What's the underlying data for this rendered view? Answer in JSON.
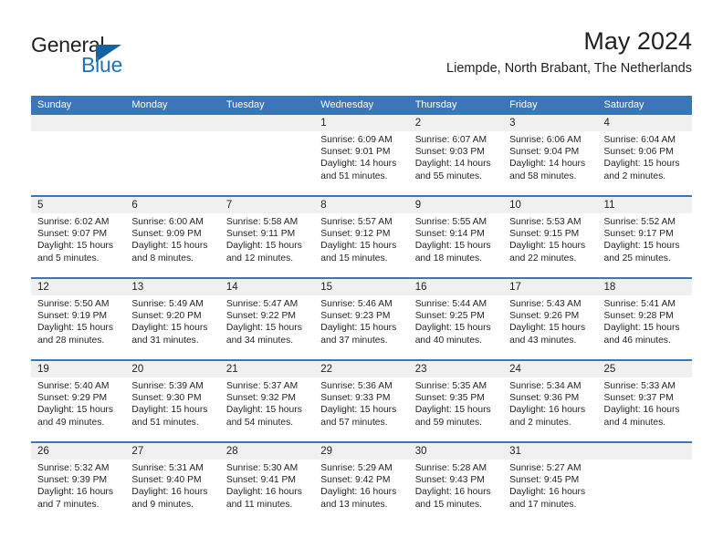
{
  "brand": {
    "line1": "General",
    "line2": "Blue",
    "logo_icon": "triangle-logo-icon",
    "accent_color": "#2272b9"
  },
  "header": {
    "title": "May 2024",
    "subtitle": "Liempde, North Brabant, The Netherlands"
  },
  "theme": {
    "header_bar_color": "#3a76b8",
    "daynum_band_color": "#f0f0f0",
    "text_color": "#231f20"
  },
  "calendar": {
    "weekday_headers": [
      "Sunday",
      "Monday",
      "Tuesday",
      "Wednesday",
      "Thursday",
      "Friday",
      "Saturday"
    ],
    "weeks": [
      [
        {
          "day": "",
          "empty": true
        },
        {
          "day": "",
          "empty": true
        },
        {
          "day": "",
          "empty": true
        },
        {
          "day": "1",
          "sunrise": "Sunrise: 6:09 AM",
          "sunset": "Sunset: 9:01 PM",
          "daylight": "Daylight: 14 hours and 51 minutes."
        },
        {
          "day": "2",
          "sunrise": "Sunrise: 6:07 AM",
          "sunset": "Sunset: 9:03 PM",
          "daylight": "Daylight: 14 hours and 55 minutes."
        },
        {
          "day": "3",
          "sunrise": "Sunrise: 6:06 AM",
          "sunset": "Sunset: 9:04 PM",
          "daylight": "Daylight: 14 hours and 58 minutes."
        },
        {
          "day": "4",
          "sunrise": "Sunrise: 6:04 AM",
          "sunset": "Sunset: 9:06 PM",
          "daylight": "Daylight: 15 hours and 2 minutes."
        }
      ],
      [
        {
          "day": "5",
          "sunrise": "Sunrise: 6:02 AM",
          "sunset": "Sunset: 9:07 PM",
          "daylight": "Daylight: 15 hours and 5 minutes."
        },
        {
          "day": "6",
          "sunrise": "Sunrise: 6:00 AM",
          "sunset": "Sunset: 9:09 PM",
          "daylight": "Daylight: 15 hours and 8 minutes."
        },
        {
          "day": "7",
          "sunrise": "Sunrise: 5:58 AM",
          "sunset": "Sunset: 9:11 PM",
          "daylight": "Daylight: 15 hours and 12 minutes."
        },
        {
          "day": "8",
          "sunrise": "Sunrise: 5:57 AM",
          "sunset": "Sunset: 9:12 PM",
          "daylight": "Daylight: 15 hours and 15 minutes."
        },
        {
          "day": "9",
          "sunrise": "Sunrise: 5:55 AM",
          "sunset": "Sunset: 9:14 PM",
          "daylight": "Daylight: 15 hours and 18 minutes."
        },
        {
          "day": "10",
          "sunrise": "Sunrise: 5:53 AM",
          "sunset": "Sunset: 9:15 PM",
          "daylight": "Daylight: 15 hours and 22 minutes."
        },
        {
          "day": "11",
          "sunrise": "Sunrise: 5:52 AM",
          "sunset": "Sunset: 9:17 PM",
          "daylight": "Daylight: 15 hours and 25 minutes."
        }
      ],
      [
        {
          "day": "12",
          "sunrise": "Sunrise: 5:50 AM",
          "sunset": "Sunset: 9:19 PM",
          "daylight": "Daylight: 15 hours and 28 minutes."
        },
        {
          "day": "13",
          "sunrise": "Sunrise: 5:49 AM",
          "sunset": "Sunset: 9:20 PM",
          "daylight": "Daylight: 15 hours and 31 minutes."
        },
        {
          "day": "14",
          "sunrise": "Sunrise: 5:47 AM",
          "sunset": "Sunset: 9:22 PM",
          "daylight": "Daylight: 15 hours and 34 minutes."
        },
        {
          "day": "15",
          "sunrise": "Sunrise: 5:46 AM",
          "sunset": "Sunset: 9:23 PM",
          "daylight": "Daylight: 15 hours and 37 minutes."
        },
        {
          "day": "16",
          "sunrise": "Sunrise: 5:44 AM",
          "sunset": "Sunset: 9:25 PM",
          "daylight": "Daylight: 15 hours and 40 minutes."
        },
        {
          "day": "17",
          "sunrise": "Sunrise: 5:43 AM",
          "sunset": "Sunset: 9:26 PM",
          "daylight": "Daylight: 15 hours and 43 minutes."
        },
        {
          "day": "18",
          "sunrise": "Sunrise: 5:41 AM",
          "sunset": "Sunset: 9:28 PM",
          "daylight": "Daylight: 15 hours and 46 minutes."
        }
      ],
      [
        {
          "day": "19",
          "sunrise": "Sunrise: 5:40 AM",
          "sunset": "Sunset: 9:29 PM",
          "daylight": "Daylight: 15 hours and 49 minutes."
        },
        {
          "day": "20",
          "sunrise": "Sunrise: 5:39 AM",
          "sunset": "Sunset: 9:30 PM",
          "daylight": "Daylight: 15 hours and 51 minutes."
        },
        {
          "day": "21",
          "sunrise": "Sunrise: 5:37 AM",
          "sunset": "Sunset: 9:32 PM",
          "daylight": "Daylight: 15 hours and 54 minutes."
        },
        {
          "day": "22",
          "sunrise": "Sunrise: 5:36 AM",
          "sunset": "Sunset: 9:33 PM",
          "daylight": "Daylight: 15 hours and 57 minutes."
        },
        {
          "day": "23",
          "sunrise": "Sunrise: 5:35 AM",
          "sunset": "Sunset: 9:35 PM",
          "daylight": "Daylight: 15 hours and 59 minutes."
        },
        {
          "day": "24",
          "sunrise": "Sunrise: 5:34 AM",
          "sunset": "Sunset: 9:36 PM",
          "daylight": "Daylight: 16 hours and 2 minutes."
        },
        {
          "day": "25",
          "sunrise": "Sunrise: 5:33 AM",
          "sunset": "Sunset: 9:37 PM",
          "daylight": "Daylight: 16 hours and 4 minutes."
        }
      ],
      [
        {
          "day": "26",
          "sunrise": "Sunrise: 5:32 AM",
          "sunset": "Sunset: 9:39 PM",
          "daylight": "Daylight: 16 hours and 7 minutes."
        },
        {
          "day": "27",
          "sunrise": "Sunrise: 5:31 AM",
          "sunset": "Sunset: 9:40 PM",
          "daylight": "Daylight: 16 hours and 9 minutes."
        },
        {
          "day": "28",
          "sunrise": "Sunrise: 5:30 AM",
          "sunset": "Sunset: 9:41 PM",
          "daylight": "Daylight: 16 hours and 11 minutes."
        },
        {
          "day": "29",
          "sunrise": "Sunrise: 5:29 AM",
          "sunset": "Sunset: 9:42 PM",
          "daylight": "Daylight: 16 hours and 13 minutes."
        },
        {
          "day": "30",
          "sunrise": "Sunrise: 5:28 AM",
          "sunset": "Sunset: 9:43 PM",
          "daylight": "Daylight: 16 hours and 15 minutes."
        },
        {
          "day": "31",
          "sunrise": "Sunrise: 5:27 AM",
          "sunset": "Sunset: 9:45 PM",
          "daylight": "Daylight: 16 hours and 17 minutes."
        },
        {
          "day": "",
          "empty": true
        }
      ]
    ]
  }
}
